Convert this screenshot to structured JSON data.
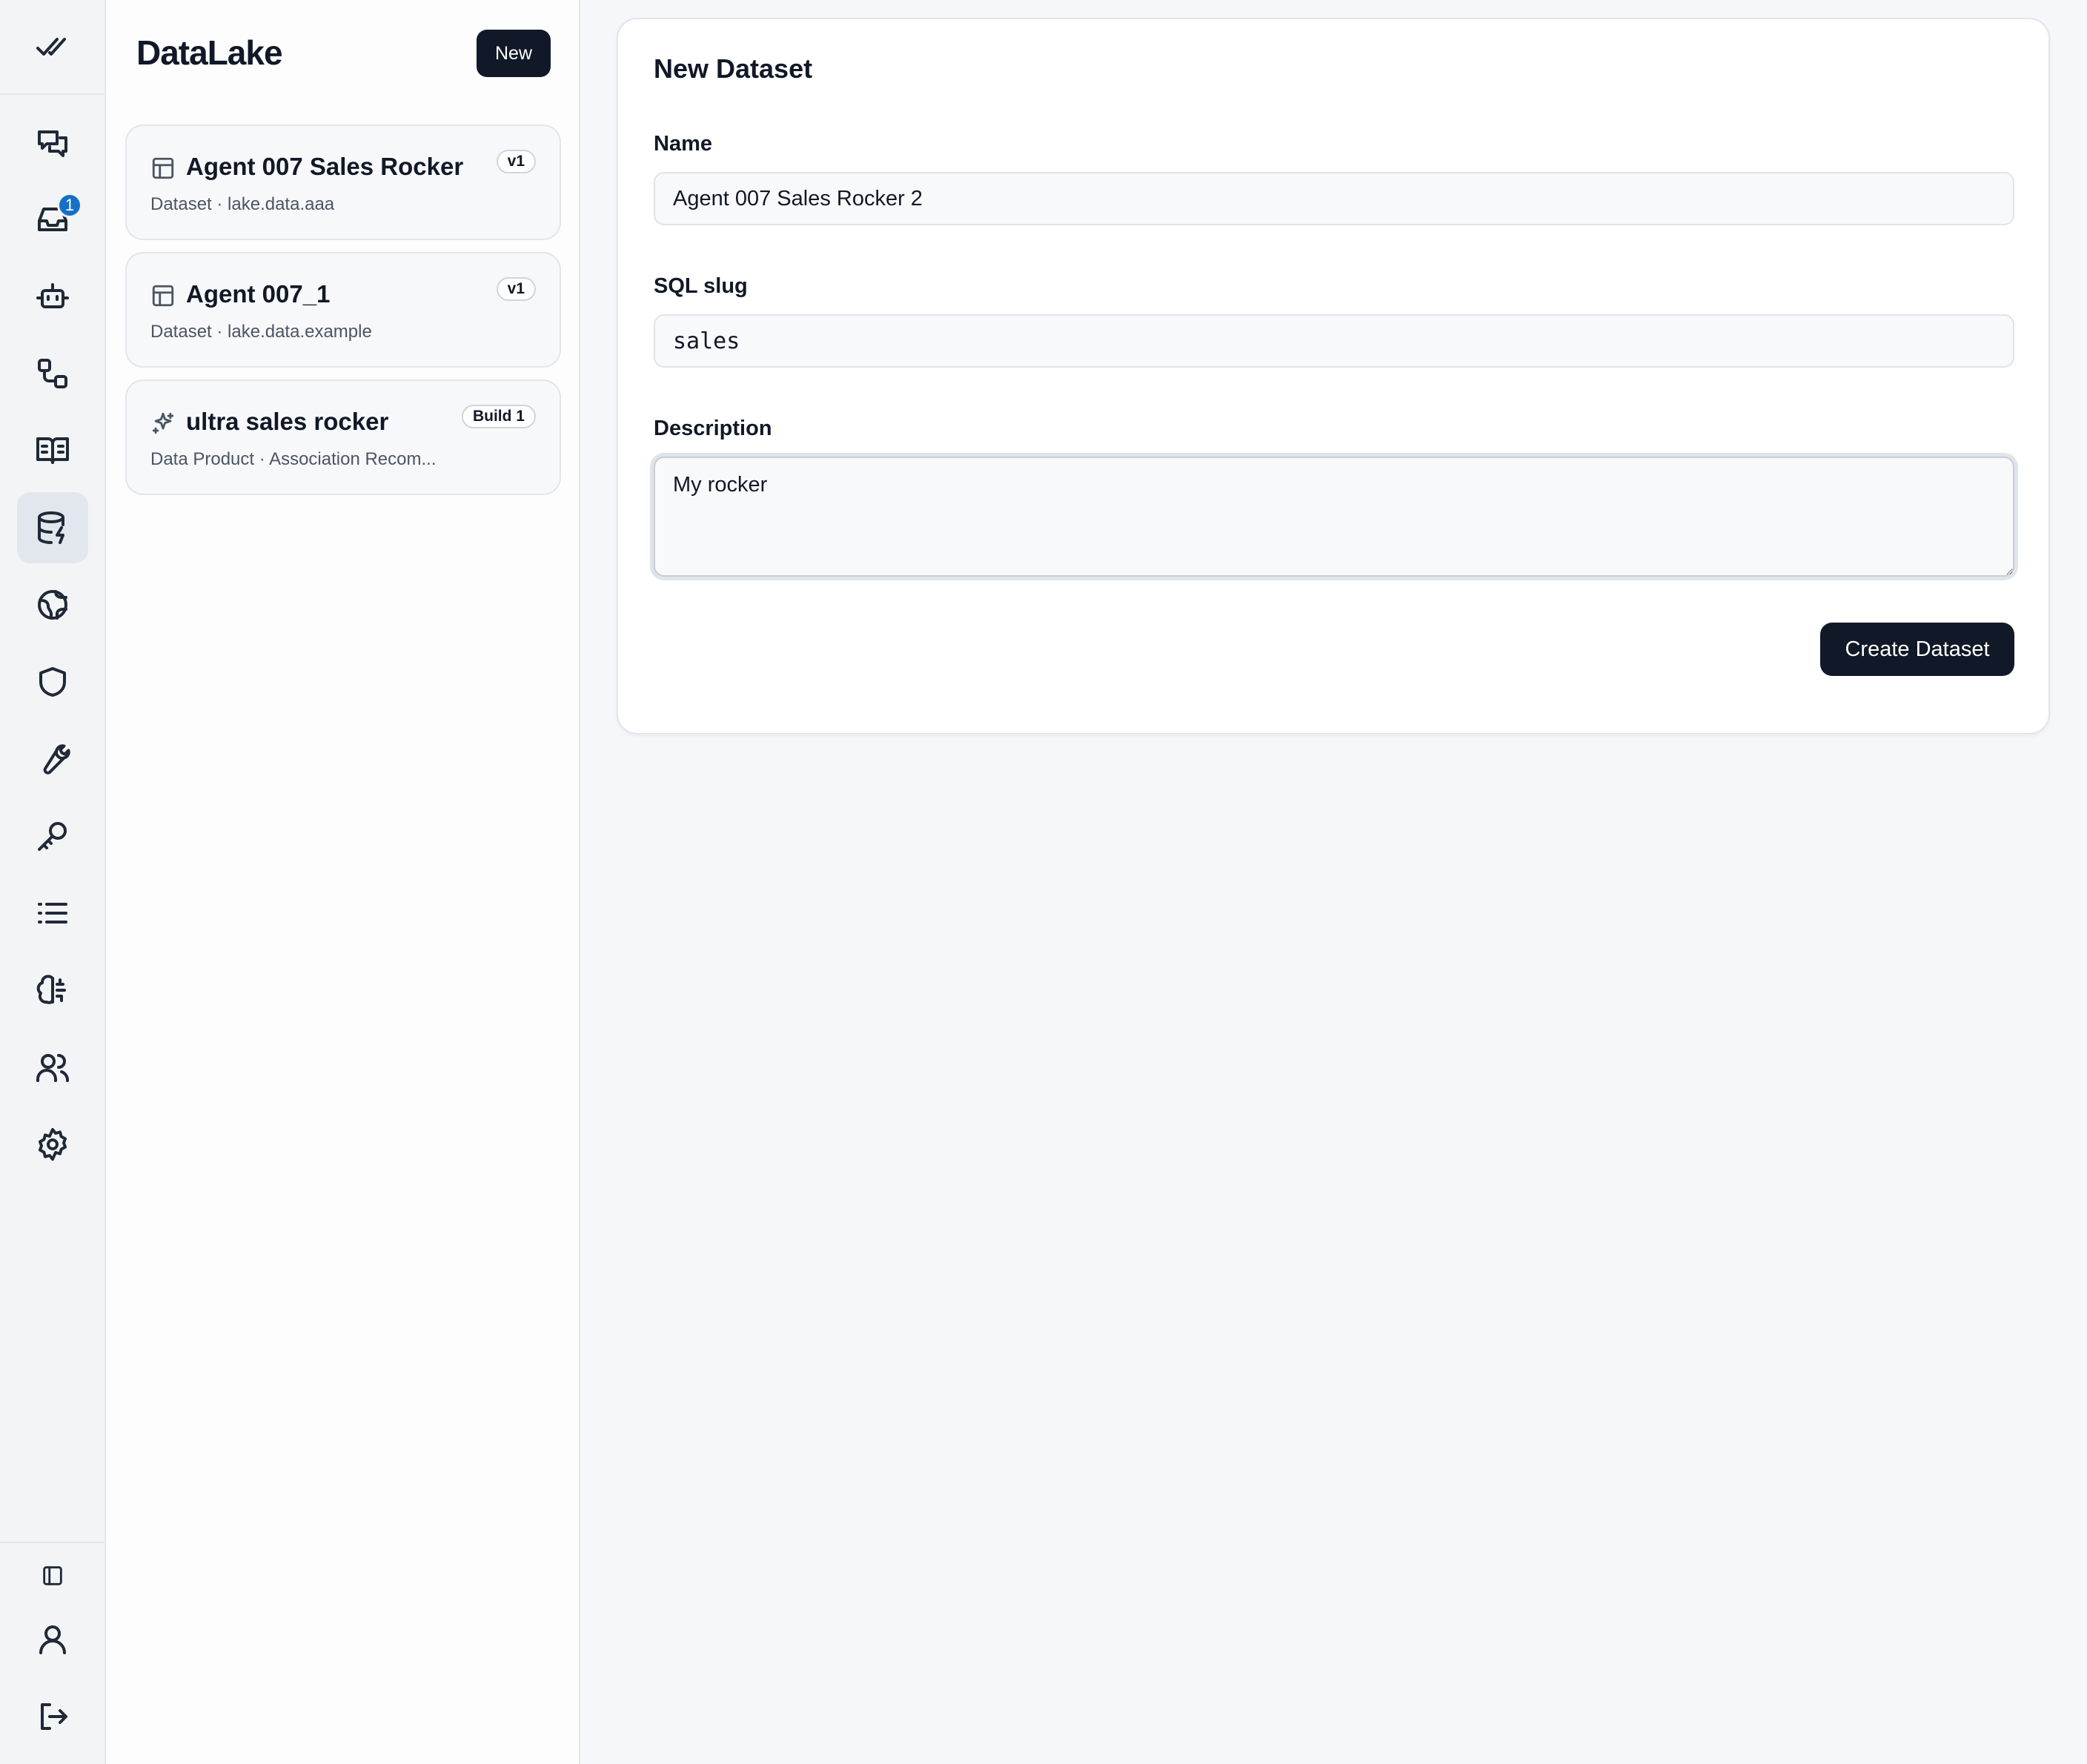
{
  "app": {
    "title": "DataLake",
    "new_label": "New"
  },
  "rail": {
    "inbox_badge": "1",
    "items": [
      "chat-icon",
      "inbox-icon",
      "bot-icon",
      "workflow-icon",
      "book-icon",
      "database-icon",
      "globe-icon",
      "shield-icon",
      "wrench-icon",
      "key-icon",
      "list-icon",
      "brain-icon",
      "users-icon",
      "gear-icon"
    ],
    "footer_items": [
      "sidebar-toggle-icon",
      "user-icon",
      "logout-icon"
    ]
  },
  "list": {
    "items": [
      {
        "title": "Agent 007 Sales Rocker",
        "subtitle": "Dataset · lake.data.aaa",
        "tag": "v1",
        "icon": "table-icon"
      },
      {
        "title": "Agent 007_1",
        "subtitle": "Dataset · lake.data.example",
        "tag": "v1",
        "icon": "table-icon"
      },
      {
        "title": "ultra sales rocker",
        "subtitle": "Data Product · Association Recom...",
        "tag": "Build 1",
        "icon": "sparkles-icon"
      }
    ]
  },
  "form": {
    "title": "New Dataset",
    "name_label": "Name",
    "name_value": "Agent 007 Sales Rocker 2",
    "slug_label": "SQL slug",
    "slug_value": "sales",
    "description_label": "Description",
    "description_value": "My rocker",
    "submit_label": "Create Dataset"
  },
  "colors": {
    "accent": "#111827",
    "badge": "#1670c7",
    "background": "#f5f7fa"
  }
}
